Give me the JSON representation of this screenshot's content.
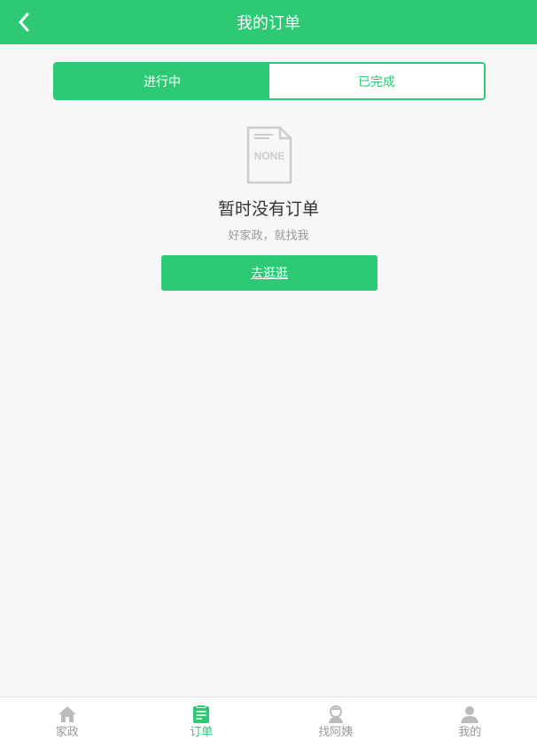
{
  "header": {
    "title": "我的订单"
  },
  "tabs": [
    {
      "label": "进行中",
      "active": true
    },
    {
      "label": "已完成",
      "active": false
    }
  ],
  "empty": {
    "icon_text": "NONE",
    "title": "暂时没有订单",
    "subtitle": "好家政，就找我",
    "button": "去逛逛"
  },
  "tabbar": [
    {
      "label": "家政",
      "icon": "house-icon",
      "active": false
    },
    {
      "label": "订单",
      "icon": "order-list-icon",
      "active": true
    },
    {
      "label": "找阿姨",
      "icon": "nanny-icon",
      "active": false
    },
    {
      "label": "我的",
      "icon": "user-icon",
      "active": false
    }
  ],
  "colors": {
    "accent": "#2dc975",
    "background": "#f7f7f7",
    "inactive": "#999999"
  }
}
